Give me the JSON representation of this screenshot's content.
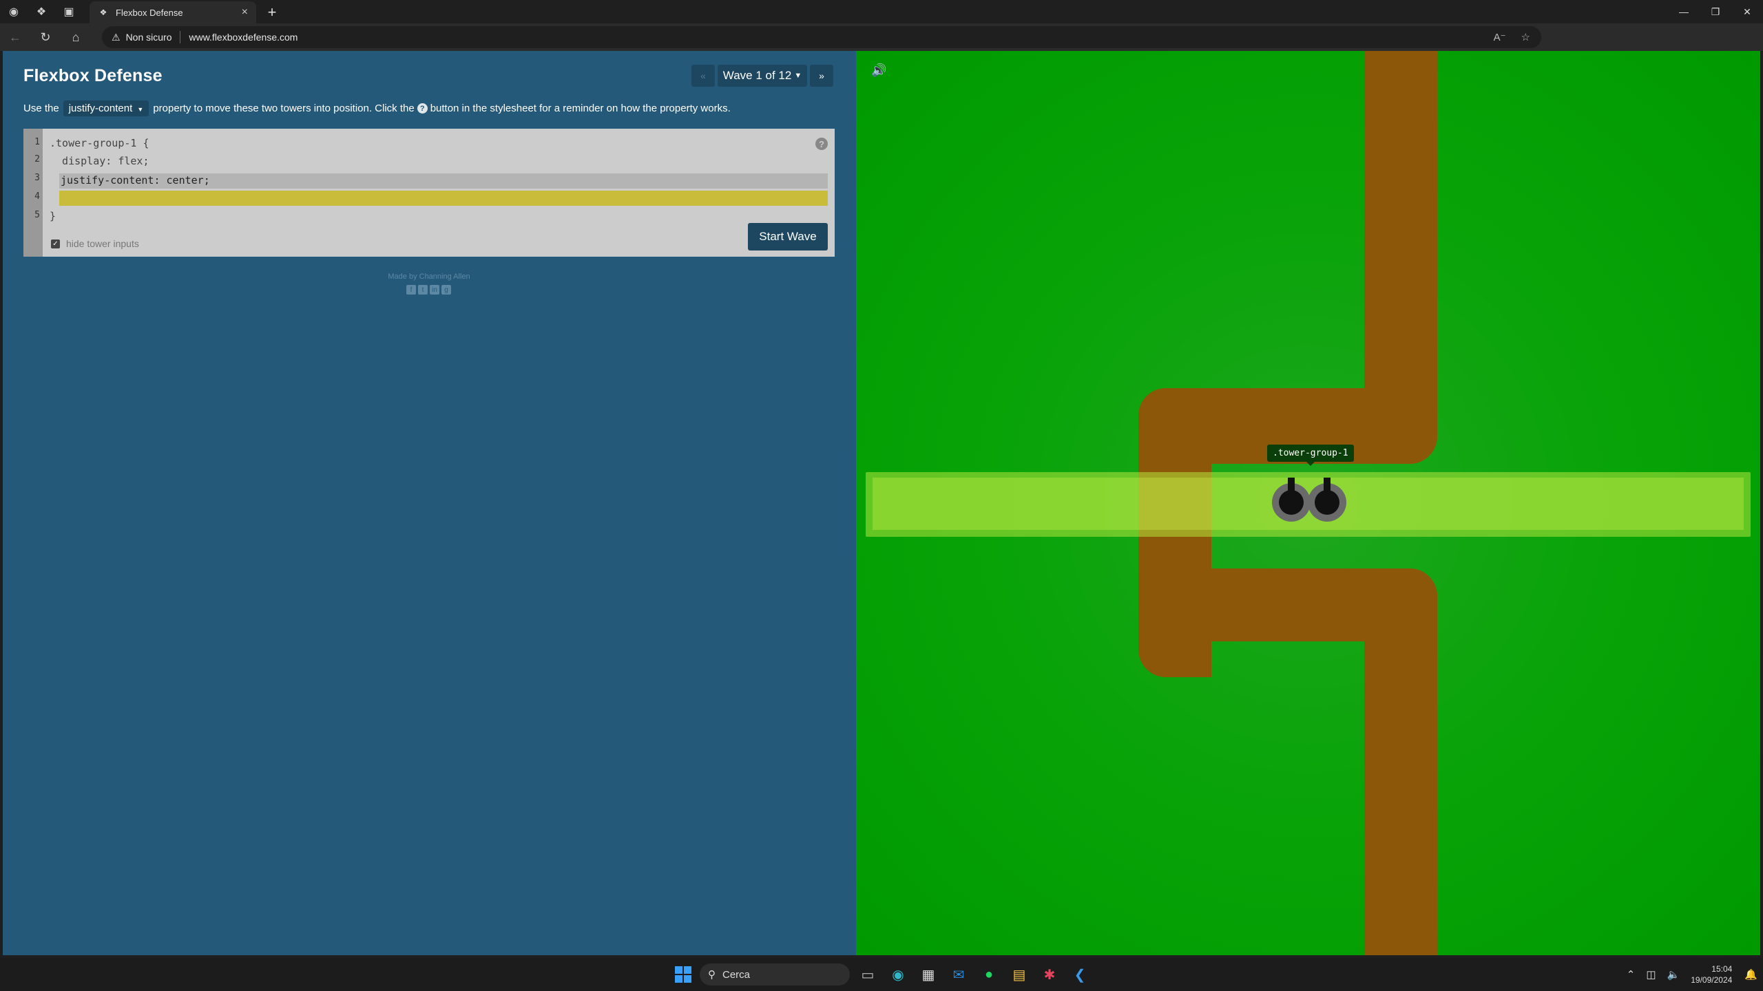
{
  "browser": {
    "tab_title": "Flexbox Defense",
    "security_label": "Non sicuro",
    "url": "www.flexboxdefense.com"
  },
  "game": {
    "title": "Flexbox Defense",
    "wave_label": "Wave 1 of 12",
    "instructions": {
      "before": "Use the",
      "property": "justify-content",
      "middle": "property to move these two towers into position. Click the",
      "after": "button in the stylesheet for a reminder on how the property works."
    },
    "code": {
      "line_numbers": [
        "1",
        "2",
        "3",
        "4",
        "5"
      ],
      "line1": ".tower-group-1 {",
      "line2": "  display: flex;",
      "line3": "justify-content: center;",
      "line4": "",
      "line5": "}"
    },
    "hide_tower_inputs_label": "hide tower inputs",
    "hide_tower_inputs_checked": true,
    "start_wave_label": "Start Wave",
    "credit": "Made by Channing Allen",
    "tower_group_label": ".tower-group-1",
    "tower_count": 2
  },
  "colors": {
    "panel": "#25597a",
    "board_green": "#07a307",
    "path_brown": "#8c5708",
    "highlight_line": "#c8bc3a"
  },
  "taskbar": {
    "search_placeholder": "Cerca",
    "time": "15:04",
    "date": "19/09/2024"
  }
}
